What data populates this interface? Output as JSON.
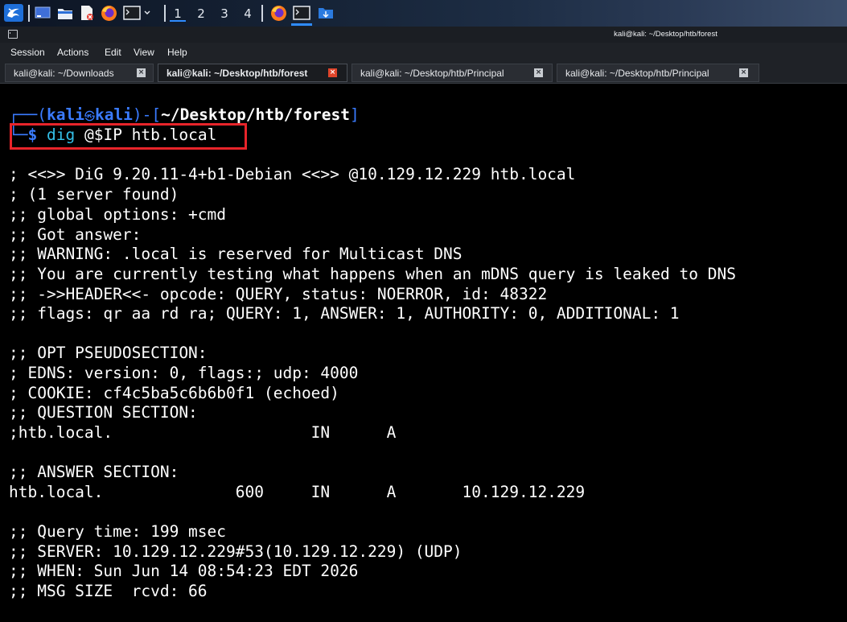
{
  "panel": {
    "workspaces": [
      "1",
      "2",
      "3",
      "4"
    ],
    "active_workspace": "1"
  },
  "window": {
    "title": "kali@kali: ~/Desktop/htb/forest"
  },
  "menu": [
    "Session",
    "Actions",
    "Edit",
    "View",
    "Help"
  ],
  "tabs": [
    {
      "label": "kali@kali: ~/Downloads",
      "active": false
    },
    {
      "label": "kali@kali: ~/Desktop/htb/forest",
      "active": true
    },
    {
      "label": "kali@kali: ~/Desktop/htb/Principal",
      "active": false
    },
    {
      "label": "kali@kali: ~/Desktop/htb/Principal",
      "active": false
    }
  ],
  "prompt": {
    "corner_top": "┌──(",
    "user": "kali",
    "at_symbol": "㉿",
    "host": "kali",
    "mid": ")-[",
    "path": "~/Desktop/htb/forest",
    "close": "]",
    "corner_bottom": "└─$",
    "command": "dig",
    "args": "@$IP htb.local"
  },
  "output": [
    "; <<>> DiG 9.20.11-4+b1-Debian <<>> @10.129.12.229 htb.local",
    "; (1 server found)",
    ";; global options: +cmd",
    ";; Got answer:",
    ";; WARNING: .local is reserved for Multicast DNS",
    ";; You are currently testing what happens when an mDNS query is leaked to DNS",
    ";; ->>HEADER<<- opcode: QUERY, status: NOERROR, id: 48322",
    ";; flags: qr aa rd ra; QUERY: 1, ANSWER: 1, AUTHORITY: 0, ADDITIONAL: 1",
    "",
    ";; OPT PSEUDOSECTION:",
    "; EDNS: version: 0, flags:; udp: 4000",
    "; COOKIE: cf4c5ba5c6b6b0f1 (echoed)",
    ";; QUESTION SECTION:",
    ";htb.local.                     IN      A",
    "",
    ";; ANSWER SECTION:",
    "htb.local.              600     IN      A       10.129.12.229",
    "",
    ";; Query time: 199 msec",
    ";; SERVER: 10.129.12.229#53(10.129.12.229) (UDP)",
    ";; WHEN: Sun Jun 14 08:54:23 EDT 2026",
    ";; MSG SIZE  rcvd: 66"
  ],
  "colors": {
    "prompt_frame": "#3a7bff",
    "prompt_user": "#3a7bff",
    "command": "#34c0e8",
    "highlight_box": "#e8242a",
    "active_tab_close": "#e0452b"
  }
}
